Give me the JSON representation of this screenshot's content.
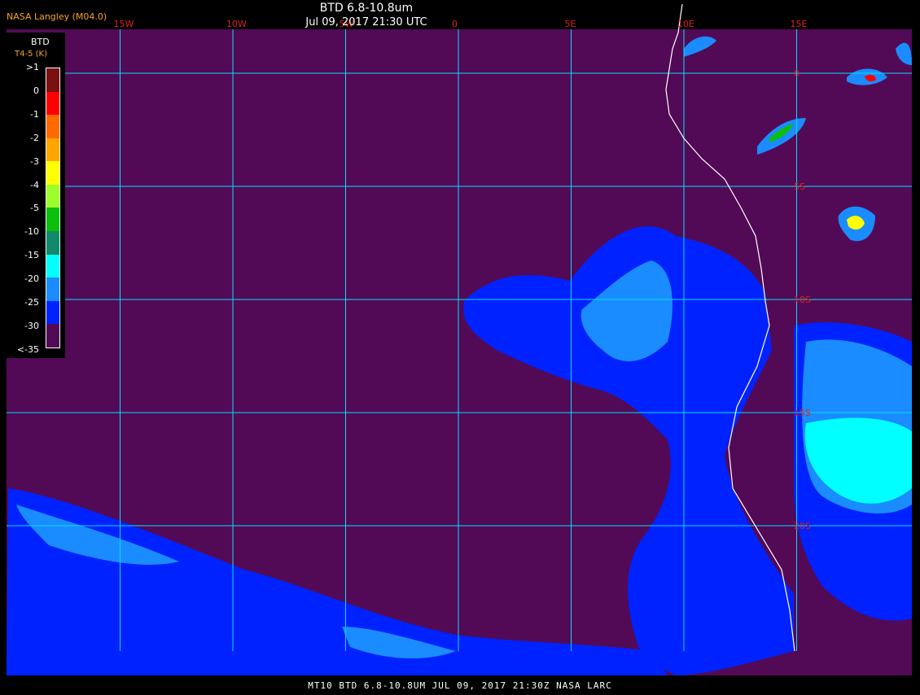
{
  "header": {
    "credit": "NASA Langley (M04.0)",
    "title": "BTD 6.8-10.8um",
    "subtitle": "Jul 09, 2017 21:30 UTC"
  },
  "footer": {
    "text": "MT10  BTD 6.8-10.8UM   JUL 09, 2017 21:30Z   NASA LARC"
  },
  "legend": {
    "label_line1": "BTD",
    "label_line2": "T4-5 (K)",
    "ticks": [
      ">1",
      "0",
      "-1",
      "-2",
      "-3",
      "-4",
      "-5",
      "-10",
      "-15",
      "-20",
      "-25",
      "-30",
      "<-35"
    ],
    "colors": [
      "#7a1010",
      "#ff0000",
      "#ff6a00",
      "#ffa500",
      "#ffff00",
      "#9cff2a",
      "#0cbf0c",
      "#108a6a",
      "#00ffff",
      "#1a8cff",
      "#0022ff",
      "#520a56"
    ]
  },
  "map": {
    "background_color": "#520a56",
    "grid_color": "#00e0ff",
    "coastline_color": "#ffffff",
    "lon_labels": [
      "15W",
      "10W",
      "5W",
      "0",
      "5E",
      "10E",
      "15E"
    ],
    "lat_labels": [
      "0",
      "5S",
      "10S",
      "15S",
      "20S"
    ],
    "lon_values": [
      -15,
      -10,
      -5,
      0,
      5,
      10,
      15
    ],
    "lat_values": [
      0,
      -5,
      -10,
      -15,
      -20
    ]
  }
}
